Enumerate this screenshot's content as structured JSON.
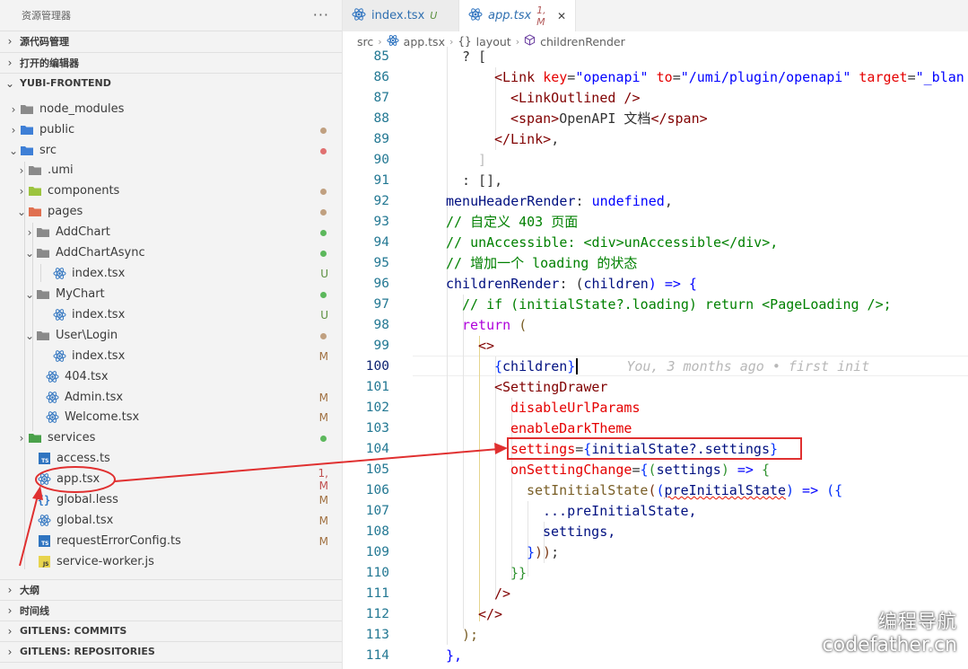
{
  "explorer": {
    "title": "资源管理器",
    "more": "···",
    "sections": {
      "source_control": "源代码管理",
      "open_editors": "打开的编辑器",
      "project": "YUBI-FRONTEND",
      "outline": "大纲",
      "timeline": "时间线",
      "gitlens_commits": "GITLENS: COMMITS",
      "gitlens_repositories": "GITLENS: REPOSITORIES"
    },
    "tree": [
      {
        "name": "node_modules",
        "status": "",
        "status_color": ""
      },
      {
        "name": "public",
        "status": "",
        "status_color": "#c0a080"
      },
      {
        "name": "src",
        "status": "",
        "status_color": "#e07070"
      },
      {
        "name": ".umi",
        "status": "",
        "status_color": ""
      },
      {
        "name": "components",
        "status": "",
        "status_color": "#c0a080"
      },
      {
        "name": "pages",
        "status": "",
        "status_color": "#c0a080"
      },
      {
        "name": "AddChart",
        "status": "",
        "status_color": "#5cb85c"
      },
      {
        "name": "AddChartAsync",
        "status": "",
        "status_color": "#5cb85c"
      },
      {
        "name": "index.tsx",
        "status": "U",
        "status_color": "#5a8f3e"
      },
      {
        "name": "MyChart",
        "status": "",
        "status_color": "#5cb85c"
      },
      {
        "name": "index.tsx",
        "status": "U",
        "status_color": "#5a8f3e"
      },
      {
        "name": "User\\Login",
        "status": "",
        "status_color": "#c0a080"
      },
      {
        "name": "index.tsx",
        "status": "M",
        "status_color": "#a07040"
      },
      {
        "name": "404.tsx",
        "status": "",
        "status_color": ""
      },
      {
        "name": "Admin.tsx",
        "status": "M",
        "status_color": "#a07040"
      },
      {
        "name": "Welcome.tsx",
        "status": "M",
        "status_color": "#a07040"
      },
      {
        "name": "services",
        "status": "",
        "status_color": "#5cb85c"
      },
      {
        "name": "access.ts",
        "status": "",
        "status_color": ""
      },
      {
        "name": "app.tsx",
        "status": "1, M",
        "status_color": "#c05050"
      },
      {
        "name": "global.less",
        "status": "M",
        "status_color": "#a07040"
      },
      {
        "name": "global.tsx",
        "status": "M",
        "status_color": "#a07040"
      },
      {
        "name": "requestErrorConfig.ts",
        "status": "M",
        "status_color": "#a07040"
      },
      {
        "name": "service-worker.js",
        "status": "",
        "status_color": ""
      }
    ]
  },
  "tabs": [
    {
      "label": "index.tsx",
      "badge": "U"
    },
    {
      "label": "app.tsx",
      "badge": "1, M",
      "close": "✕"
    }
  ],
  "breadcrumb": [
    "src",
    "app.tsx",
    "layout",
    "childrenRender"
  ],
  "line_numbers": [
    "85",
    "86",
    "87",
    "88",
    "89",
    "90",
    "91",
    "92",
    "93",
    "94",
    "95",
    "96",
    "97",
    "98",
    "99",
    "100",
    "101",
    "102",
    "103",
    "104",
    "105",
    "106",
    "107",
    "108",
    "109",
    "110",
    "111",
    "112",
    "113",
    "114"
  ],
  "code_text": {
    "l85": "? [",
    "l86a": "<Link ",
    "l86b": "key",
    "l86c": "=",
    "l86d": "\"openapi\"",
    "l86e": " to",
    "l86f": "=",
    "l86g": "\"/umi/plugin/openapi\"",
    "l86h": " target",
    "l86i": "=",
    "l86j": "\"_blan",
    "l87": "<LinkOutlined />",
    "l88a": "<span>",
    "l88b": "OpenAPI 文档",
    "l88c": "</span>",
    "l89a": "</Link>",
    "l89b": ",",
    "l90": "]",
    "l91": ": [],",
    "l92a": "menuHeaderRender",
    "l92b": ": ",
    "l92c": "undefined",
    "l92d": ",",
    "l93": "// 自定义 403 页面",
    "l94": "// unAccessible: <div>unAccessible</div>,",
    "l95": "// 增加一个 loading 的状态",
    "l96a": "childrenRender",
    "l96b": ": (",
    "l96c": "children",
    "l96d": ") => {",
    "l97": "// if (initialState?.loading) return <PageLoading />;",
    "l98a": "return",
    "l98b": " (",
    "l99": "<>",
    "l100a": "{",
    "l100b": "children",
    "l100c": "}",
    "l100blame": "You, 3 months ago • first init",
    "l101": "<SettingDrawer",
    "l102": "disableUrlParams",
    "l103": "enableDarkTheme",
    "l104a": "settings",
    "l104b": "=",
    "l104c": "{",
    "l104d": "initialState?.settings",
    "l104e": "}",
    "l105a": "onSettingChange",
    "l105b": "=",
    "l105c": "{",
    "l105d": "(",
    "l105e": "settings",
    "l105f": ")",
    "l105g": " => ",
    "l105h": "{",
    "l106a": "setInitialState",
    "l106b": "(",
    "l106c": "(",
    "l106d": "preInitialState",
    "l106e": ")",
    "l106f": " => ",
    "l106g": "({",
    "l107": "...preInitialState,",
    "l108": "settings,",
    "l109a": "}",
    "l109b": "))",
    "l109c": ";",
    "l110": "}}",
    "l111": "/>",
    "l112": "</>",
    "l113": ");",
    "l114": "},"
  },
  "watermark": {
    "line1": "编程导航",
    "line2": "codefather.cn"
  },
  "colors": {
    "accent": "#e03030",
    "link_blue": "#2f6fb0"
  }
}
